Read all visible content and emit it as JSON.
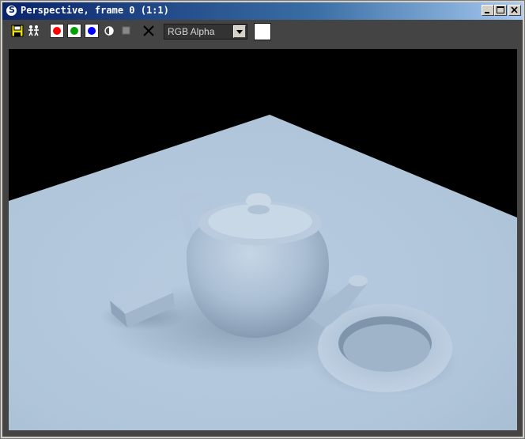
{
  "window": {
    "title": "Perspective, frame 0 (1:1)",
    "app_icon": "3ds-max-icon"
  },
  "title_buttons": [
    "minimize-icon",
    "maximize-icon",
    "close-icon"
  ],
  "toolbar": {
    "save_icon": "floppy-disk-icon",
    "clone_icon": "clone-people-icon",
    "channels": {
      "red": "#ff0000",
      "green": "#00a000",
      "blue": "#0000ff"
    },
    "monochrome_icon": "half-circle-icon",
    "clear_icon": "x-icon",
    "channel_select": {
      "value": "RGB Alpha"
    },
    "swatch_color": "#ffffff"
  },
  "render": {
    "background": "#000000",
    "floor_color": "#b4c8dc"
  }
}
